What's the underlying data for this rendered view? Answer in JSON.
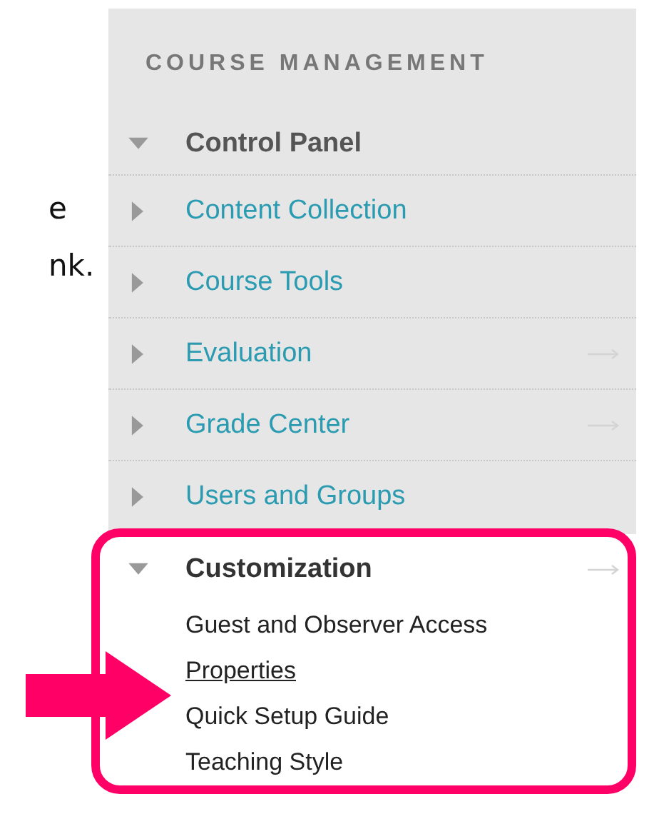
{
  "text_fragments": [
    "e",
    "nk."
  ],
  "panel": {
    "title": "COURSE MANAGEMENT",
    "header": {
      "label": "Control Panel",
      "expanded": true
    },
    "items": [
      {
        "label": "Content Collection",
        "expanded": false,
        "go_arrow": false
      },
      {
        "label": "Course Tools",
        "expanded": false,
        "go_arrow": false
      },
      {
        "label": "Evaluation",
        "expanded": false,
        "go_arrow": true
      },
      {
        "label": "Grade Center",
        "expanded": false,
        "go_arrow": true
      },
      {
        "label": "Users and Groups",
        "expanded": false,
        "go_arrow": false
      }
    ]
  },
  "highlight": {
    "label": "Customization",
    "expanded": true,
    "go_arrow": true,
    "children": [
      {
        "label": "Guest and Observer Access",
        "selected": false
      },
      {
        "label": "Properties",
        "selected": true
      },
      {
        "label": "Quick Setup Guide",
        "selected": false
      },
      {
        "label": "Teaching Style",
        "selected": false
      }
    ]
  }
}
